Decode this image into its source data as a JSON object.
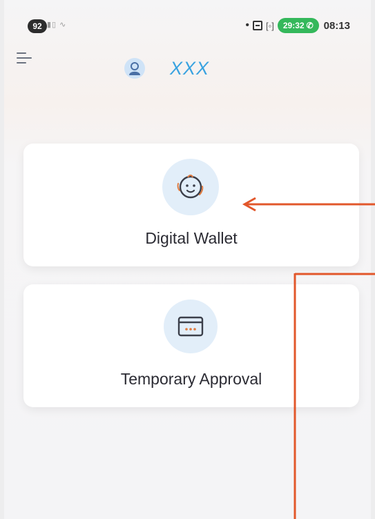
{
  "status_bar": {
    "notification_count": "92",
    "call_timer": "29:32",
    "time": "08:13"
  },
  "header": {
    "user_name": "XXX"
  },
  "cards": {
    "digital_wallet_label": "Digital Wallet",
    "temporary_approval_label": "Temporary Approval"
  },
  "icons": {
    "menu": "menu-icon",
    "avatar": "user-avatar-icon",
    "wallet": "baby-face-icon",
    "approval": "card-icon"
  },
  "colors": {
    "accent": "#3aa3e0",
    "call_green": "#34b85b",
    "annotation": "#e2572b",
    "icon_bg": "#e2eef9"
  }
}
